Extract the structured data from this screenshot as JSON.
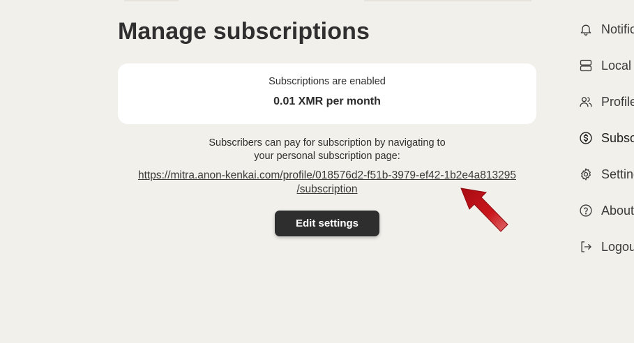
{
  "page": {
    "title": "Manage subscriptions"
  },
  "status_card": {
    "status": "Subscriptions are enabled",
    "price": "0.01 XMR per month"
  },
  "info": {
    "line1": "Subscribers can pay for subscription by navigating to",
    "line2": "your personal subscription page:"
  },
  "subscription_link": {
    "line1": "https://mitra.anon-kenkai.com/profile/018576d2-f51b-3979-ef42-1b2e4a813295",
    "line2": "/subscription"
  },
  "actions": {
    "edit_label": "Edit settings"
  },
  "sidebar": {
    "items": [
      {
        "label": "Notifications",
        "icon": "bell-icon"
      },
      {
        "label": "Local",
        "icon": "server-icon"
      },
      {
        "label": "Profile directory",
        "icon": "users-icon"
      },
      {
        "label": "Subscriptions",
        "icon": "dollar-circle-icon",
        "active": true
      },
      {
        "label": "Settings",
        "icon": "gear-icon"
      },
      {
        "label": "About",
        "icon": "help-circle-icon"
      },
      {
        "label": "Logout",
        "icon": "logout-icon"
      }
    ]
  },
  "colors": {
    "background": "#f2f0eb",
    "card": "#ffffff",
    "button": "#2e2e2e",
    "annotation_arrow": "#c0141a"
  }
}
